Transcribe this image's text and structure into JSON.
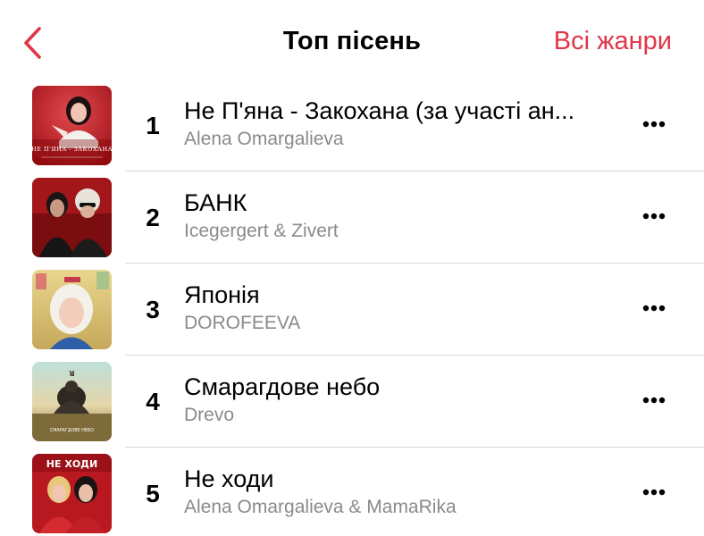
{
  "header": {
    "back_icon": "chevron-left-icon",
    "title": "Топ пісень",
    "all_genres_label": "Всі жанри",
    "accent_color": "#e1354a"
  },
  "songs": [
    {
      "rank": "1",
      "title": "Не П'яна - Закохана (за участі ан...",
      "artist": "Alena Omargalieva",
      "artwork_text": "НЕ П'ЯНА - ЗАКОХАНА",
      "more_icon": "ellipsis-icon"
    },
    {
      "rank": "2",
      "title": "БАНК",
      "artist": "Icegergert & Zivert",
      "more_icon": "ellipsis-icon"
    },
    {
      "rank": "3",
      "title": "Японія",
      "artist": "DOROFEEVA",
      "more_icon": "ellipsis-icon"
    },
    {
      "rank": "4",
      "title": "Смарагдове небо",
      "artist": "Drevo",
      "artwork_text": "СМАРАГДОВЕ НЕБО",
      "more_icon": "ellipsis-icon"
    },
    {
      "rank": "5",
      "title": "Не ходи",
      "artist": "Alena Omargalieva & MamaRika",
      "artwork_text": "НЕ ХОДИ",
      "more_icon": "ellipsis-icon"
    }
  ]
}
